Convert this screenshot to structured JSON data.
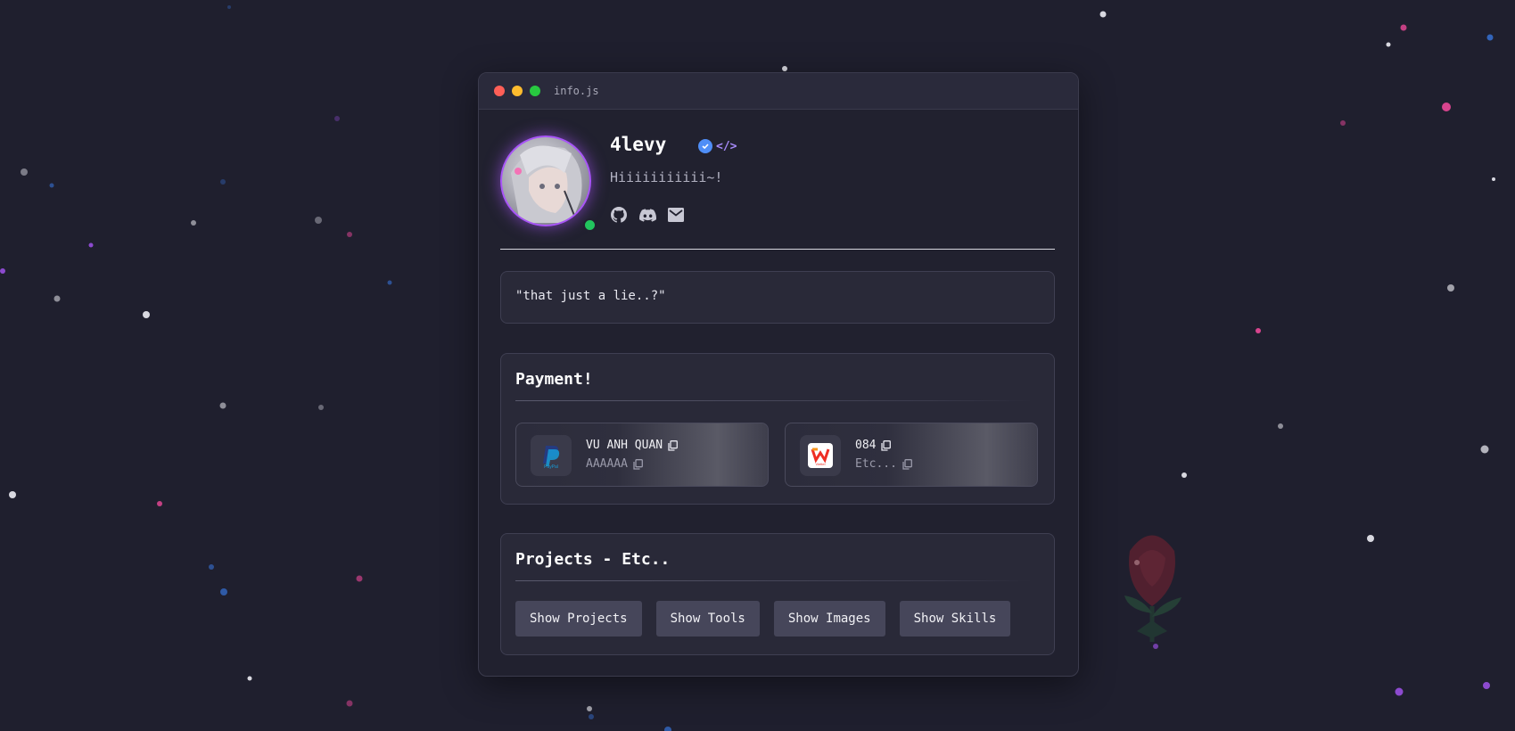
{
  "window": {
    "title": "info.js",
    "controls": [
      "close",
      "minimize",
      "maximize"
    ]
  },
  "profile": {
    "username": "4levy",
    "badges": [
      "verified-icon",
      "code-icon"
    ],
    "bio": "Hiiiiiiiiiii~!",
    "status": "online",
    "socials": [
      "github-icon",
      "discord-icon",
      "mail-icon"
    ]
  },
  "quote": {
    "text": "\"that just a lie..?\""
  },
  "payment": {
    "title": "Payment!",
    "items": [
      {
        "icon": "paypal-icon",
        "name": "VU ANH QUAN",
        "detail": "AAAAAA"
      },
      {
        "icon": "viettel-money-icon",
        "name": "084",
        "detail": "Etc..."
      }
    ]
  },
  "projects": {
    "title": "Projects - Etc..",
    "buttons": [
      "Show Projects",
      "Show Tools",
      "Show Images",
      "Show Skills"
    ]
  },
  "colors": {
    "background": "#1f1f2e",
    "accent": "#a855f7",
    "online": "#22c55e",
    "verified": "#4f8ef7"
  }
}
